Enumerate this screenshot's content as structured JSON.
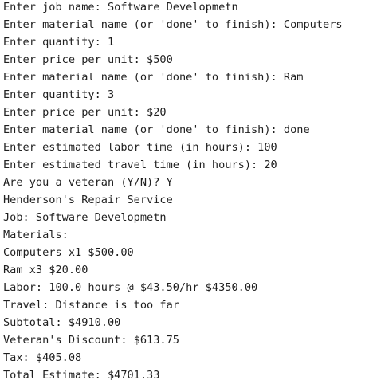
{
  "console": {
    "lines": [
      "Enter job name: Software Developmetn",
      "Enter material name (or 'done' to finish): Computers",
      "Enter quantity: 1",
      "Enter price per unit: $500",
      "Enter material name (or 'done' to finish): Ram",
      "Enter quantity: 3",
      "Enter price per unit: $20",
      "Enter material name (or 'done' to finish): done",
      "Enter estimated labor time (in hours): 100",
      "Enter estimated travel time (in hours): 20",
      "Are you a veteran (Y/N)? Y",
      "Henderson's Repair Service",
      "Job: Software Developmetn",
      "Materials:",
      "Computers x1 $500.00",
      "Ram x3 $20.00",
      "Labor: 100.0 hours @ $43.50/hr $4350.00",
      "Travel: Distance is too far",
      "Subtotal: $4910.00",
      "Veteran's Discount: $613.75",
      "Tax: $405.08",
      "Total Estimate: $4701.33"
    ]
  }
}
